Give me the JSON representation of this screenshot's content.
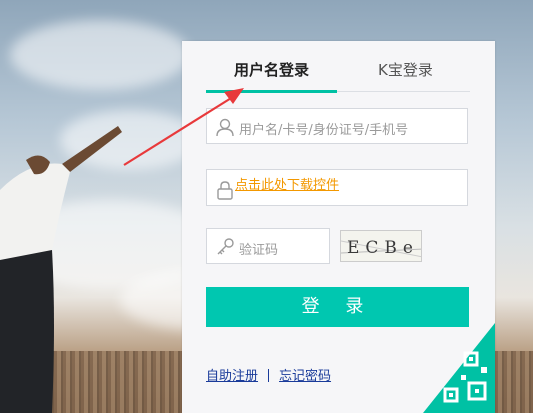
{
  "tabs": [
    {
      "label": "用户名登录",
      "active": true
    },
    {
      "label": "K宝登录",
      "active": false
    }
  ],
  "form": {
    "username_placeholder": "用户名/卡号/身份证号/手机号",
    "control_link": "点击此处下载控件",
    "captcha_placeholder": "验证码",
    "captcha_text": "ECBe",
    "login_button": "登 录"
  },
  "links": {
    "register": "自助注册",
    "forgot": "忘记密码"
  },
  "colors": {
    "accent": "#00c7b0",
    "link": "#1a3b9a",
    "warning_link": "#f39800",
    "annotation_arrow": "#e8393b"
  },
  "icons": {
    "user": "user-icon",
    "lock": "lock-icon",
    "key": "key-icon",
    "qr": "qr-code-icon"
  }
}
